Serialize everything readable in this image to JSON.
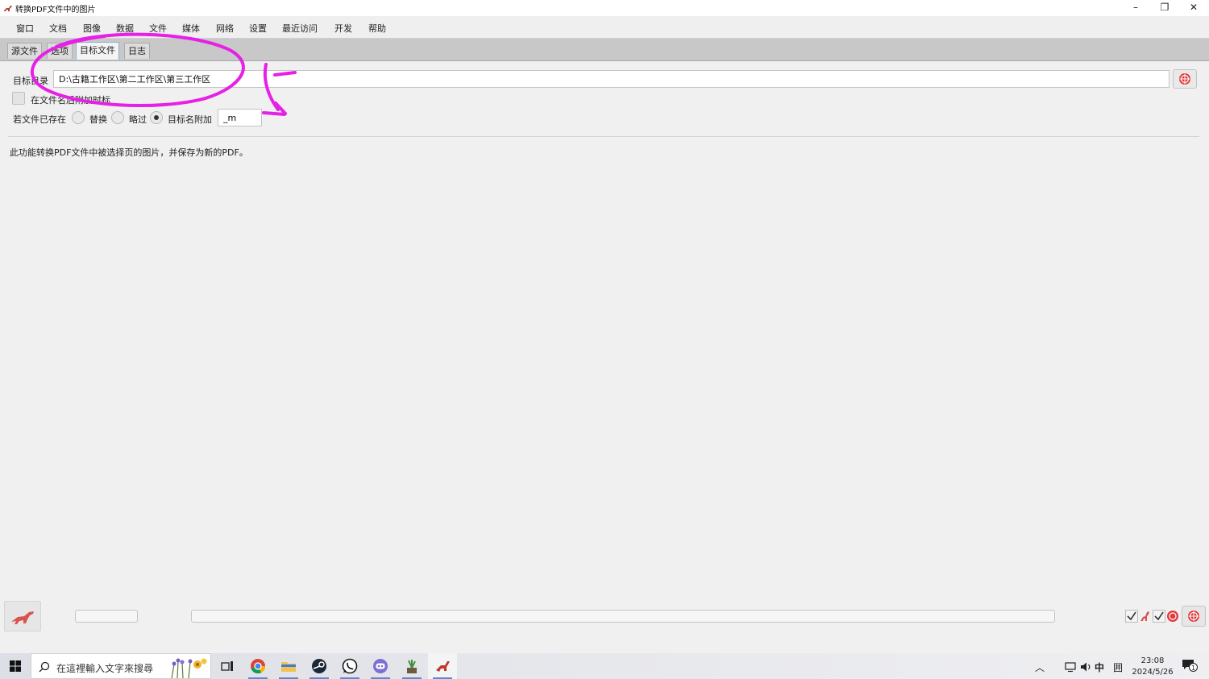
{
  "window": {
    "title": "转换PDF文件中的图片",
    "icon": "app-dinosaur-icon",
    "controls": {
      "minimize": "–",
      "restore": "❐",
      "close": "✕"
    }
  },
  "menu": [
    "窗口",
    "文档",
    "图像",
    "数据",
    "文件",
    "媒体",
    "网络",
    "设置",
    "最近访问",
    "开发",
    "帮助"
  ],
  "tabs": [
    {
      "label": "源文件",
      "active": false
    },
    {
      "label": "选项",
      "active": false
    },
    {
      "label": "目标文件",
      "active": true
    },
    {
      "label": "日志",
      "active": false
    }
  ],
  "form": {
    "target_dir_label": "目标目录",
    "target_dir_value": "D:\\古籍工作区\\第二工作区\\第三工作区",
    "timestamp_checkbox_label": "在文件名后附加时标",
    "timestamp_checked": false,
    "if_exists_label": "若文件已存在",
    "options": [
      {
        "label": "替换",
        "selected": false
      },
      {
        "label": "略过",
        "selected": false
      },
      {
        "label": "目标名附加",
        "selected": true
      }
    ],
    "suffix_value": "_m"
  },
  "description": "此功能转换PDF文件中被选择页的图片，并保存为新的PDF。",
  "annotation": {
    "color": "#e620e6"
  },
  "bottom": {
    "small_progress": 0,
    "main_progress": 0,
    "status_icons": [
      "check-icon",
      "dinosaur-icon",
      "check-icon",
      "stop-icon"
    ]
  },
  "taskbar": {
    "search_placeholder": "在這裡輸入文字來搜尋",
    "apps": [
      "task-view-icon",
      "chrome-icon",
      "file-explorer-icon",
      "steam-icon",
      "whatsapp-icon",
      "discord-icon",
      "plant-app-icon",
      "mybox-icon"
    ],
    "tray": {
      "ime": "中",
      "layout": "囲",
      "time": "23:08",
      "date": "2024/5/26",
      "notification_count": "1"
    }
  }
}
